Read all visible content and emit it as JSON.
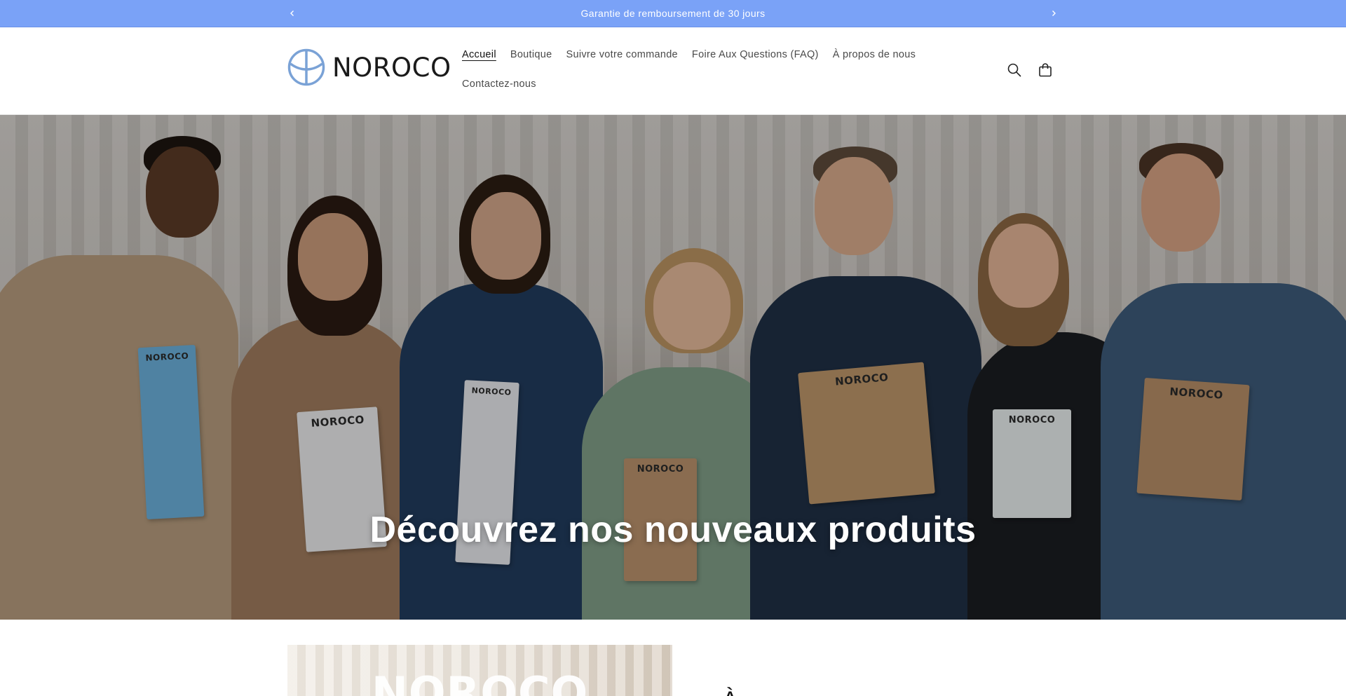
{
  "announcement": {
    "text": "Garantie de remboursement de 30 jours",
    "prev_icon": "chevron-left-icon",
    "next_icon": "chevron-right-icon"
  },
  "header": {
    "logo_text": "NOROCO",
    "logo_color": "#7aa2d6",
    "nav": [
      {
        "label": "Accueil",
        "active": true
      },
      {
        "label": "Boutique"
      },
      {
        "label": "Suivre votre commande"
      },
      {
        "label": "Foire Aux Questions (FAQ)"
      },
      {
        "label": "À propos de nous"
      },
      {
        "label": "Contactez-nous"
      }
    ],
    "icons": [
      "search-icon",
      "cart-icon"
    ]
  },
  "hero": {
    "title": "Découvrez nos nouveaux produits",
    "box_brand": "NOROCO"
  },
  "promo": {
    "image_brand": "NOROCO",
    "heading_peek": "À"
  },
  "colors": {
    "announcement_bg": "#7aa2f7",
    "text_dark": "#121212"
  }
}
